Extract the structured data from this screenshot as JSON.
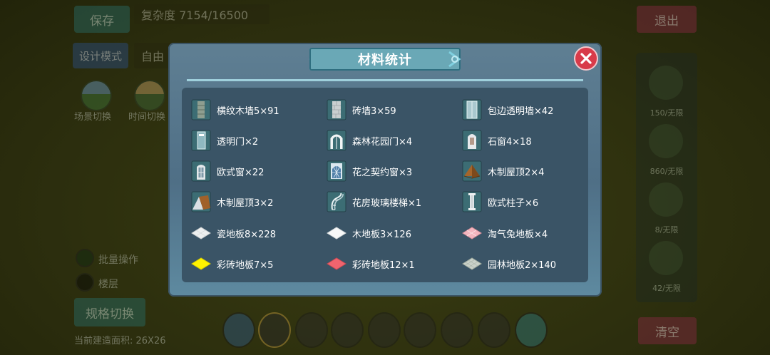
{
  "background": {
    "save_button": "保存",
    "complexity": "复杂度 7154/16500",
    "exit_button": "退出",
    "design_mode_button": "设计模式",
    "free_mode_field": "自由",
    "scene_switch_label": "场景切换",
    "time_switch_label": "时间切换",
    "batch_operation_label": "批量操作",
    "floor_stack_label": "楼层",
    "spec_switch_button": "规格切换",
    "build_area_label": "当前建造面积: 26X26",
    "clear_button": "清空",
    "right_panel": [
      {
        "label": "150/无限",
        "icon": "wall-icon"
      },
      {
        "label": "860/无限",
        "icon": "grid-window-icon"
      },
      {
        "label": "8/无限",
        "icon": "door-icon"
      },
      {
        "label": "42/无限",
        "icon": "stair-icon"
      }
    ],
    "toolbar": [
      {
        "icon": "eraser-icon"
      },
      {
        "icon": "wood-door-icon"
      },
      {
        "icon": "gray-door-icon"
      },
      {
        "icon": "dark-door-icon"
      },
      {
        "icon": "green-door-icon"
      },
      {
        "icon": "cabinet-icon"
      },
      {
        "icon": "purple-window-icon"
      },
      {
        "icon": "brown-window-icon"
      },
      {
        "icon": "more-icon"
      }
    ]
  },
  "dialog": {
    "title": "材料统计",
    "items": [
      {
        "label": "横纹木墙5×91",
        "icon": "striped-wood-wall-icon"
      },
      {
        "label": "砖墙3×59",
        "icon": "brick-wall-icon"
      },
      {
        "label": "包边透明墙×42",
        "icon": "glass-wall-icon"
      },
      {
        "label": "透明门×2",
        "icon": "glass-door-icon"
      },
      {
        "label": "森林花园门×4",
        "icon": "forest-garden-door-icon"
      },
      {
        "label": "石窗4×18",
        "icon": "stone-window-icon"
      },
      {
        "label": "欧式窗×22",
        "icon": "european-window-icon"
      },
      {
        "label": "花之契约窗×3",
        "icon": "flower-window-icon"
      },
      {
        "label": "木制屋顶2×4",
        "icon": "pyramid-roof-icon"
      },
      {
        "label": "木制屋顶3×2",
        "icon": "gable-roof-icon"
      },
      {
        "label": "花房玻璃楼梯×1",
        "icon": "glass-stair-icon"
      },
      {
        "label": "欧式柱子×6",
        "icon": "european-pillar-icon"
      },
      {
        "label": "瓷地板8×228",
        "icon": "white-tile-icon"
      },
      {
        "label": "木地板3×126",
        "icon": "white-floor-icon"
      },
      {
        "label": "淘气兔地板×4",
        "icon": "pink-floor-icon"
      },
      {
        "label": "彩砖地板7×5",
        "icon": "yellow-tile-icon"
      },
      {
        "label": "彩砖地板12×1",
        "icon": "red-tile-icon"
      },
      {
        "label": "园林地板2×140",
        "icon": "garden-floor-icon"
      }
    ]
  },
  "colors": {
    "dialog_bg": "#5a7b90",
    "title_banner": "#6aa8b6",
    "close_button": "#d83b4a"
  }
}
